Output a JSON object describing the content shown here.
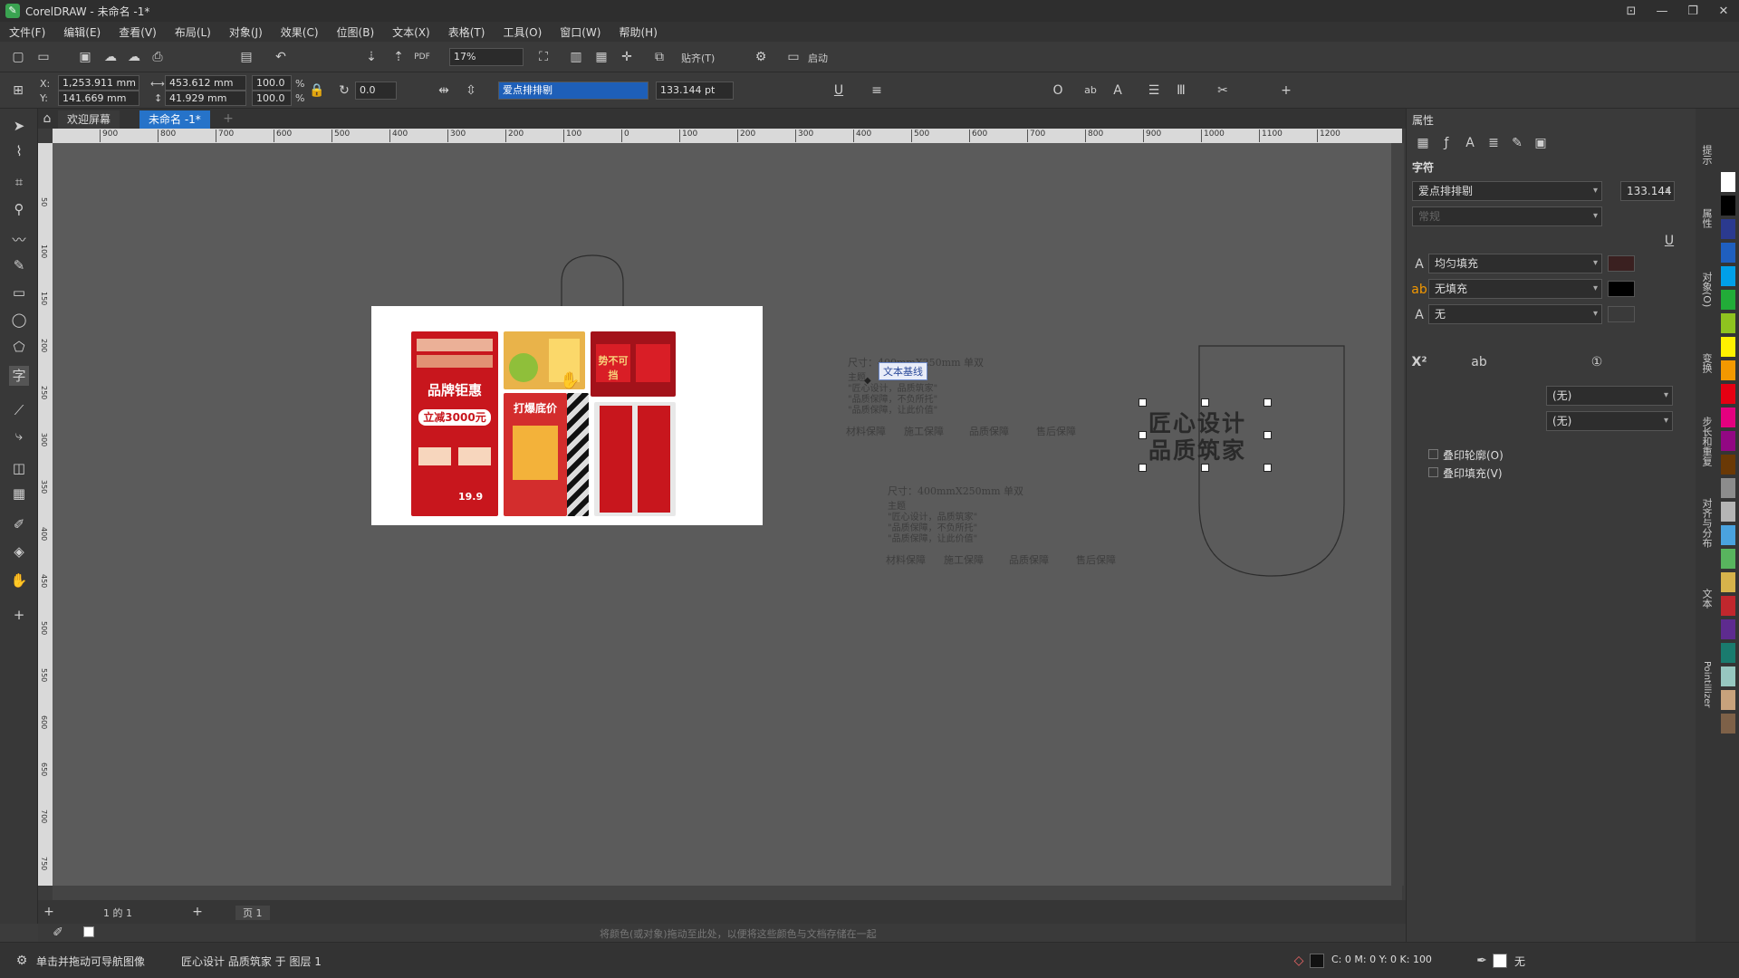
{
  "window": {
    "title": "CorelDRAW - 未命名 -1*"
  },
  "menu": [
    "文件(F)",
    "编辑(E)",
    "查看(V)",
    "布局(L)",
    "对象(J)",
    "效果(C)",
    "位图(B)",
    "文本(X)",
    "表格(T)",
    "工具(O)",
    "窗口(W)",
    "帮助(H)"
  ],
  "toolbar": {
    "zoom": "17%",
    "snap_label": "贴齐(T)",
    "launch_label": "启动"
  },
  "propbar": {
    "x_label": "X:",
    "x_value": "1,253.911 mm",
    "y_label": "Y:",
    "y_value": "141.669 mm",
    "width_value": "453.612 mm",
    "height_value": "41.929 mm",
    "scale_w": "100.0",
    "scale_h": "100.0",
    "percent": "%",
    "rotation": "0.0",
    "font_name": "爱点排排剔",
    "font_size": "133.144 pt"
  },
  "tabs": {
    "welcome": "欢迎屏幕",
    "doc": "未命名 -1*"
  },
  "ruler_h": [
    "900",
    "800",
    "700",
    "600",
    "500",
    "400",
    "300",
    "200",
    "100",
    "0",
    "100",
    "200",
    "300",
    "400",
    "500",
    "600",
    "700",
    "800",
    "900",
    "1000",
    "1100",
    "1200"
  ],
  "ruler_v": [
    "50",
    "100",
    "150",
    "200",
    "250",
    "300",
    "350",
    "400",
    "450",
    "500",
    "550",
    "600",
    "650",
    "700",
    "750"
  ],
  "canvas": {
    "tooltip": "文本基线",
    "dim1": "尺寸：400mmX250mm 单双",
    "dim2": "尺寸：400mmX250mm 单双",
    "lines1": [
      "主题",
      "\"匠心设计，品质筑家\"",
      "\"品质保障，不负所托\"",
      "\"品质保障，让此价值\""
    ],
    "lines2": [
      "主题",
      "\"匠心设计，品质筑家\"",
      "\"品质保障，不负所托\"",
      "\"品质保障，让此价值\""
    ],
    "footer1": [
      "材料保障",
      "施工保障",
      "品质保障",
      "售后保障"
    ],
    "footer2": [
      "材料保障",
      "施工保障",
      "品质保障",
      "售后保障"
    ],
    "selected_line1": "匠心设计",
    "selected_line2": "品质筑家",
    "posters": {
      "p1_title": "品牌钜惠",
      "p1_sub": "立减3000元",
      "p1_price": "19.9",
      "p3_title": "势不可挡",
      "p4_title": "打爆底价"
    }
  },
  "pages": {
    "counter": "1 的 1",
    "page_tab": "页 1"
  },
  "hint": "将颜色(或对象)拖动至此处，以便将这些颜色与文档存储在一起",
  "status": {
    "left_text": "单击并拖动可导航图像",
    "object_info": "匠心设计 品质筑家 于 图层 1",
    "color_info": "C: 0 M: 0 Y: 0 K: 100",
    "outline": "无"
  },
  "properties": {
    "title": "属性",
    "section": "字符",
    "font": "爱点排排剔",
    "font_size": "133.144",
    "style_placeholder": "常规",
    "fill1": "均匀填充",
    "fill2": "无填充",
    "fill3": "无",
    "drop1": "(无)",
    "drop2": "(无)",
    "cb1": "叠印轮廓(O)",
    "cb2": "叠印填充(V)"
  },
  "dockers": [
    "提示",
    "属性",
    "对象(O)",
    "变换",
    "步长和重复",
    "对齐与分布",
    "文本",
    "Pointillizer"
  ],
  "palette": [
    "#ffffff",
    "#000000",
    "#2b3a8f",
    "#1f5fbf",
    "#00a0e9",
    "#22ac38",
    "#8fc31f",
    "#fff100",
    "#f39800",
    "#e60012",
    "#e4007f",
    "#920783",
    "#6a3906",
    "#8c8c8c",
    "#b5b5b5",
    "#4aa3df",
    "#58b45e",
    "#d6b34b",
    "#c1272d",
    "#5e2b8f",
    "#1a7b6e",
    "#97c7c0",
    "#c8a27c",
    "#7e6148"
  ],
  "colors": {
    "selection_text": "#2a2a2a",
    "canvas_bg": "#5b5b5b",
    "poster_red": "#c8161d"
  }
}
